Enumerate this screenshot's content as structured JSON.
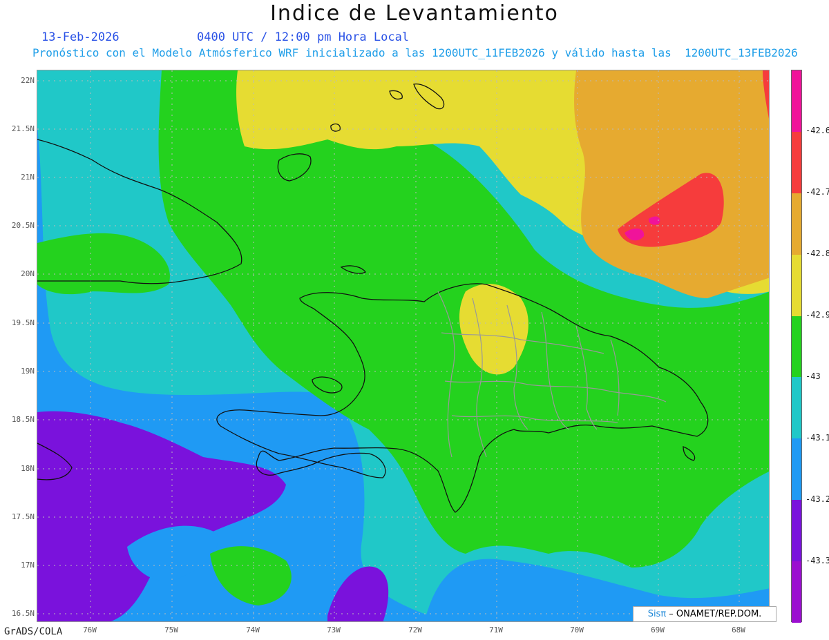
{
  "header": {
    "title": "Indice de Levantamiento",
    "date": "13-Feb-2026",
    "time_text": "0400 UTC / 12:00 pm Hora Local",
    "description": "Pronóstico con el Modelo Atmósferico WRF inicializado a las 1200UTC_11FEB2026 y válido hasta las  1200UTC_13FEB2026"
  },
  "axes": {
    "lat_labels": [
      "22N",
      "21.5N",
      "21N",
      "20.5N",
      "20N",
      "19.5N",
      "19N",
      "18.5N",
      "18N",
      "17.5N",
      "17N",
      "16.5N"
    ],
    "lon_labels": [
      "76W",
      "75W",
      "74W",
      "73W",
      "72W",
      "71W",
      "70W",
      "69W",
      "68W"
    ]
  },
  "colorbar": {
    "labels": [
      "-42.6",
      "-42.7",
      "-42.8",
      "-42.9",
      "-43",
      "-43.1",
      "-43.2",
      "-43.3"
    ],
    "colors": [
      "#f0139a",
      "#f63c3c",
      "#e6aa30",
      "#e6dc32",
      "#24d21e",
      "#20c8c8",
      "#1f9af4",
      "#7a12dc",
      "#9b0fd0"
    ]
  },
  "footer": {
    "credit": "GrADS/COLA",
    "brand_sis": "Sisπ",
    "brand_rest": " – ONAMET/REP.DOM."
  }
}
